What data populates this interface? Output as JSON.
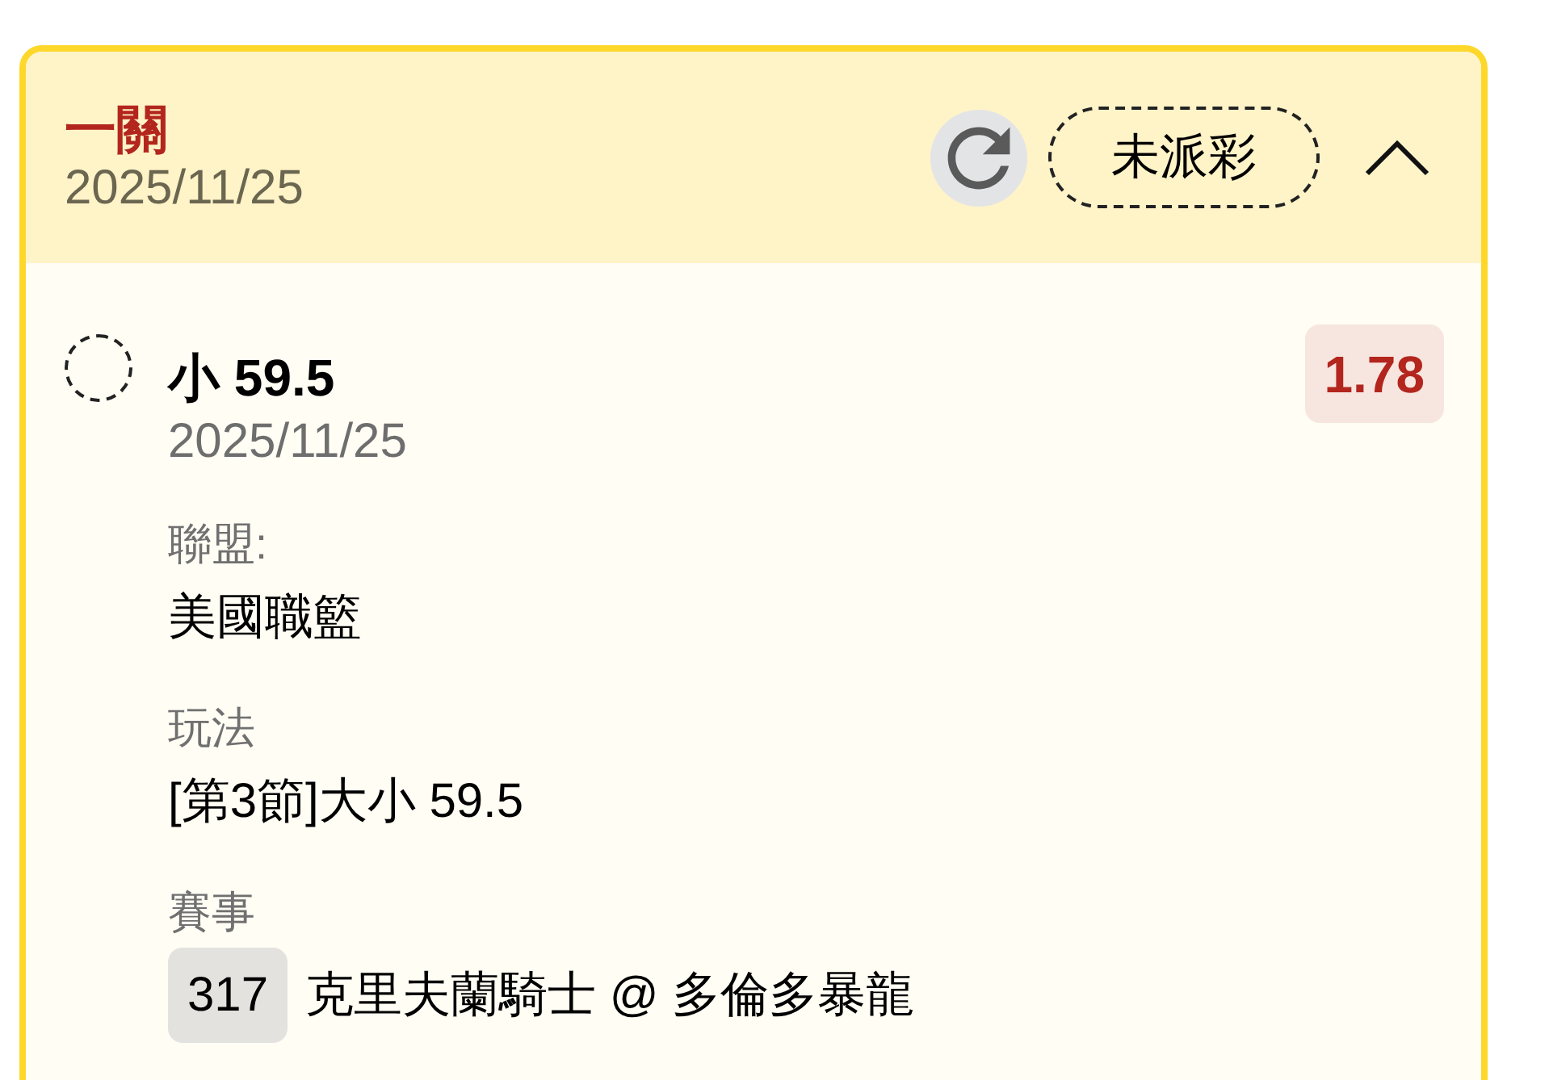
{
  "card": {
    "title": "一關",
    "date": "2025/11/25",
    "status": "未派彩",
    "expanded": true
  },
  "bets": [
    {
      "selection": "小 59.5",
      "date": "2025/11/25",
      "odds": "1.78",
      "selected": false,
      "details": [
        {
          "kind": "text",
          "label": "聯盟:",
          "value": "美國職籃"
        },
        {
          "kind": "text",
          "label": "玩法",
          "value": "[第3節]大小 59.5"
        },
        {
          "kind": "match",
          "label": "賽事",
          "number": "317",
          "value": "克里夫蘭騎士 @ 多倫多暴龍"
        }
      ]
    }
  ]
}
